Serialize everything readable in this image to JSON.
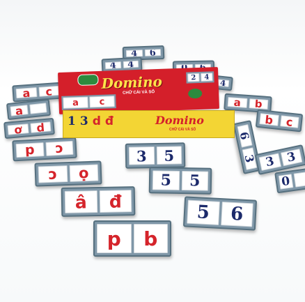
{
  "box": {
    "brand": "Domino",
    "subtitle": "CHỮ CÁI VÀ SỐ",
    "brand_side": "Domino",
    "subtitle_side": "CHỮ CÁI VÀ SỐ",
    "lid_tiles": [
      {
        "left": "a",
        "right": "c"
      },
      {
        "left": "2",
        "right": "4"
      }
    ],
    "side_letters": [
      "1",
      "3",
      "d",
      "đ"
    ],
    "colors": {
      "lid": "#d41f2a",
      "body": "#f3d534",
      "accent": "#2d8a3e"
    }
  },
  "tiles": [
    {
      "id": "t1",
      "left": "4",
      "right": "6"
    },
    {
      "id": "t2",
      "left": "4",
      "right": "4"
    },
    {
      "id": "t3",
      "left": "0",
      "right": "6"
    },
    {
      "id": "t4",
      "left": "a",
      "right": "c"
    },
    {
      "id": "t5",
      "left": "a",
      "right": ""
    },
    {
      "id": "t6",
      "left": "ơ",
      "right": "d"
    },
    {
      "id": "t7",
      "left": "p",
      "right": "ɔ"
    },
    {
      "id": "t8",
      "left": "ɔ",
      "right": "ọ"
    },
    {
      "id": "t9",
      "left": "â",
      "right": "đ"
    },
    {
      "id": "t10",
      "left": "p",
      "right": "b"
    },
    {
      "id": "t11",
      "left": "3",
      "right": "5"
    },
    {
      "id": "t12",
      "left": "5",
      "right": "5"
    },
    {
      "id": "t13",
      "left": "5",
      "right": "6"
    },
    {
      "id": "t14",
      "left": "a",
      "right": "b"
    },
    {
      "id": "t15",
      "left": "b",
      "right": "c"
    },
    {
      "id": "t16",
      "left": "6",
      "right": "3"
    },
    {
      "id": "t17",
      "left": "3",
      "right": "3"
    },
    {
      "id": "t18",
      "left": "0",
      "right": ""
    },
    {
      "id": "t19",
      "left": "4",
      "right": "4"
    }
  ]
}
